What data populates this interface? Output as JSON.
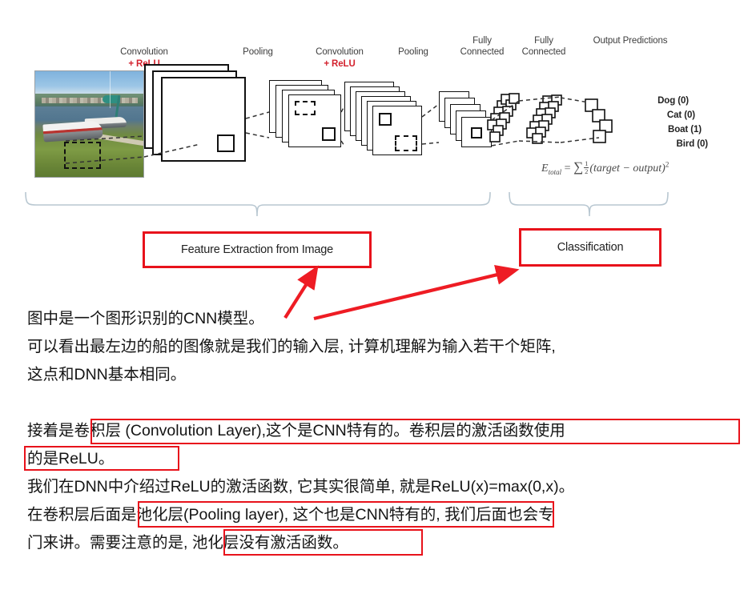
{
  "figure": {
    "stages": [
      {
        "name": "convolution-1",
        "label": "Convolution",
        "sub": "+ ReLU"
      },
      {
        "name": "pooling-1",
        "label": "Pooling",
        "sub": ""
      },
      {
        "name": "convolution-2",
        "label": "Convolution",
        "sub": "+ ReLU"
      },
      {
        "name": "pooling-2",
        "label": "Pooling",
        "sub": ""
      },
      {
        "name": "fully-connected-1",
        "label": "Fully\nConnected",
        "sub": ""
      },
      {
        "name": "fully-connected-2",
        "label": "Fully\nConnected",
        "sub": ""
      },
      {
        "name": "output-predictions",
        "label": "Output Predictions",
        "sub": ""
      }
    ],
    "predictions": [
      {
        "label": "Dog (0)"
      },
      {
        "label": "Cat (0)"
      },
      {
        "label": "Boat (1)"
      },
      {
        "label": "Bird (0)"
      }
    ],
    "loss_formula": {
      "lhs": "E",
      "lhs_sub": "total",
      "eq": "=",
      "sigma": "∑",
      "frac_num": "1",
      "frac_den": "2",
      "body": "(target − output)",
      "power": "2"
    },
    "sections": [
      {
        "name": "feature-extraction",
        "label": "Feature Extraction from Image"
      },
      {
        "name": "classification",
        "label": "Classification"
      }
    ],
    "accent_red": "#e8121b",
    "relu_red": "#d3212d",
    "brace_color": "#b8c7d1"
  },
  "body": {
    "paragraph1": [
      "图中是一个图形识别的CNN模型。",
      "可以看出最左边的船的图像就是我们的输入层, 计算机理解为输入若干个矩阵,",
      "这点和DNN基本相同。"
    ],
    "paragraph2": [
      "接着是卷积层 (Convolution Layer),这个是CNN特有的。卷积层的激活函数使用",
      "的是ReLU。",
      "我们在DNN中介绍过ReLU的激活函数, 它其实很简单, 就是ReLU(x)=max(0,x)。",
      "在卷积层后面是池化层(Pooling layer), 这个也是CNN特有的, 我们后面也会专",
      "门来讲。需要注意的是, 池化层没有激活函数。"
    ],
    "highlights": [
      {
        "name": "highlight-convolution-layer-line1"
      },
      {
        "name": "highlight-convolution-layer-line2"
      },
      {
        "name": "highlight-pooling-layer-line1"
      },
      {
        "name": "highlight-pooling-layer-line2"
      }
    ]
  }
}
